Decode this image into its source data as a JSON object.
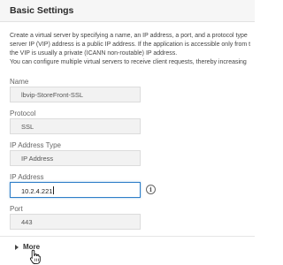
{
  "header": {
    "title": "Basic Settings"
  },
  "description": {
    "lines": [
      "Create a virtual server by specifying a name, an IP address, a port, and a protocol type",
      "server IP (VIP) address is a public IP address. If the application is accessible only from t",
      "the VIP is usually a private (ICANN non-routable) IP address.",
      "You can configure multiple virtual servers to receive client requests, thereby increasing"
    ]
  },
  "form": {
    "name": {
      "label": "Name",
      "value": "lbvip-StoreFront-SSL"
    },
    "protocol": {
      "label": "Protocol",
      "value": "SSL"
    },
    "ip_address_type": {
      "label": "IP Address Type",
      "value": "IP Address"
    },
    "ip_address": {
      "label": "IP Address",
      "value": "10.2.4.221"
    },
    "port": {
      "label": "Port",
      "value": "443"
    }
  },
  "more": {
    "label": "More"
  },
  "icons": {
    "info": "info-circle-icon",
    "expand": "caret-right-icon",
    "cursor": "hand-pointer-icon"
  },
  "colors": {
    "focus_border": "#2f7fc8",
    "header_bg": "#f6f6f6",
    "field_bg": "#f2f2f2"
  }
}
